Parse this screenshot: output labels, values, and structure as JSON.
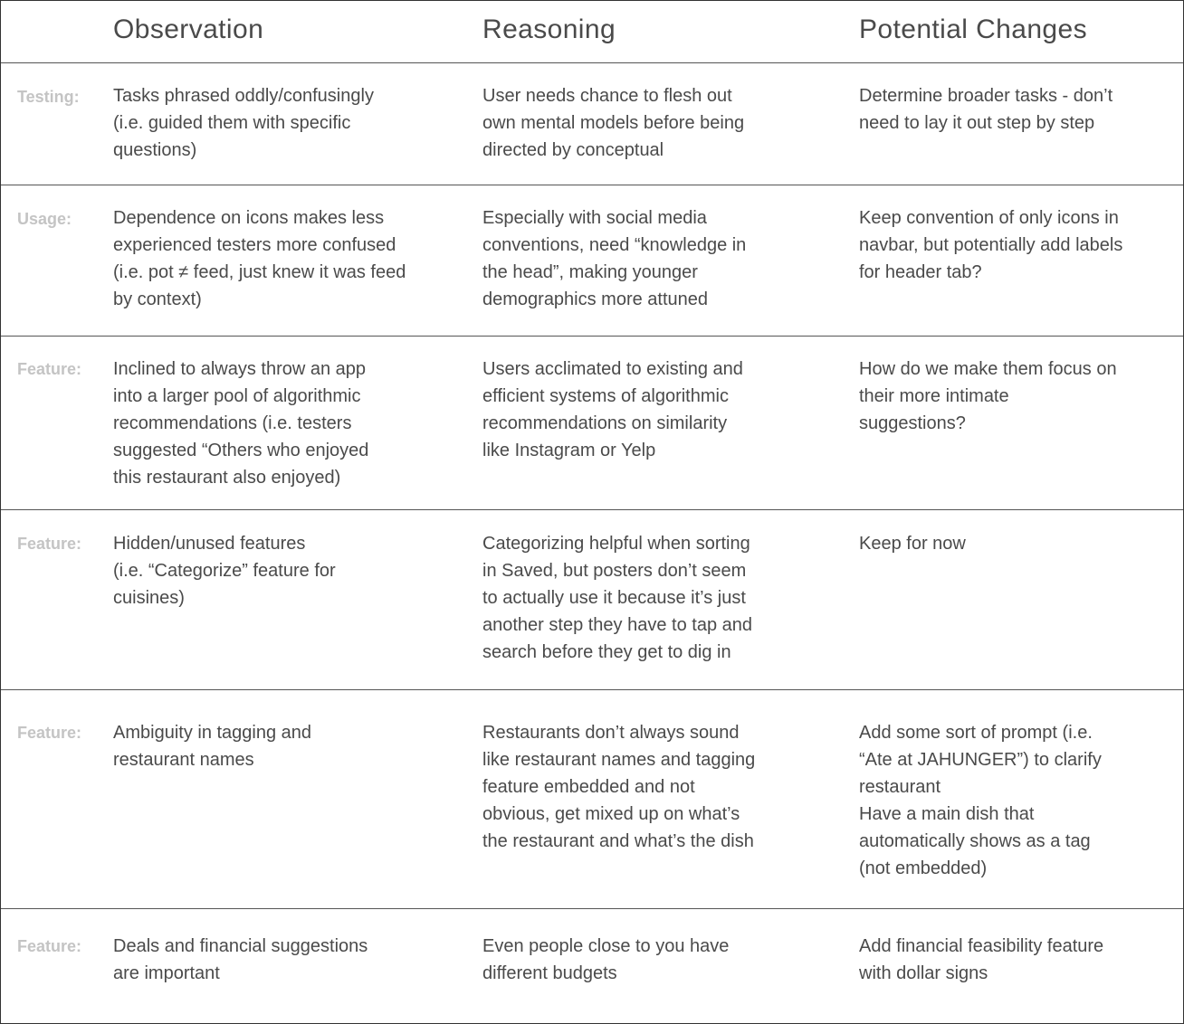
{
  "header": {
    "observation": "Observation",
    "reasoning": "Reasoning",
    "potential_changes": "Potential Changes"
  },
  "rows": [
    {
      "label": "Testing:",
      "observation": "Tasks phrased oddly/confusingly\n(i.e. guided them with specific\nquestions)",
      "reasoning": "User needs chance to flesh out\nown mental models before being\ndirected by conceptual",
      "potential_changes": "Determine broader tasks - don’t\nneed to lay it out step by step"
    },
    {
      "label": "Usage:",
      "observation": "Dependence on icons makes less\nexperienced testers more confused\n(i.e. pot ≠ feed, just knew it was feed\nby context)",
      "reasoning": "Especially with social media\nconventions, need “knowledge in\nthe head”, making younger\ndemographics more attuned",
      "potential_changes": "Keep convention of only icons in\nnavbar, but potentially add labels\nfor header tab?"
    },
    {
      "label": "Feature:",
      "observation": "Inclined to always throw an app\ninto a larger pool of algorithmic\nrecommendations (i.e. testers\nsuggested “Others who enjoyed\nthis restaurant also enjoyed)",
      "reasoning": "Users acclimated to existing and\nefficient systems of algorithmic\nrecommendations on similarity\nlike Instagram or Yelp",
      "potential_changes": "How do we make them focus on\ntheir more intimate\nsuggestions?"
    },
    {
      "label": "Feature:",
      "observation": "Hidden/unused features\n(i.e. “Categorize” feature for\ncuisines)",
      "reasoning": "Categorizing helpful when sorting\nin Saved, but posters don’t seem\nto actually use it because it’s just\nanother step they have to tap and\nsearch before they get to dig in",
      "potential_changes": "Keep for now"
    },
    {
      "label": "Feature:",
      "observation": "Ambiguity in tagging and\nrestaurant names",
      "reasoning": "Restaurants don’t always sound\nlike restaurant names and tagging\nfeature embedded and not\nobvious, get mixed up on what’s\nthe restaurant and what’s the dish",
      "potential_changes": "Add some sort of prompt (i.e.\n“Ate at JAHUNGER”) to clarify\nrestaurant\nHave a main dish that\nautomatically shows as a tag\n(not embedded)"
    },
    {
      "label": "Feature:",
      "observation": "Deals and financial suggestions\nare important",
      "reasoning": "Even people close to you have\ndifferent budgets",
      "potential_changes": "Add financial feasibility feature\nwith dollar signs"
    }
  ]
}
